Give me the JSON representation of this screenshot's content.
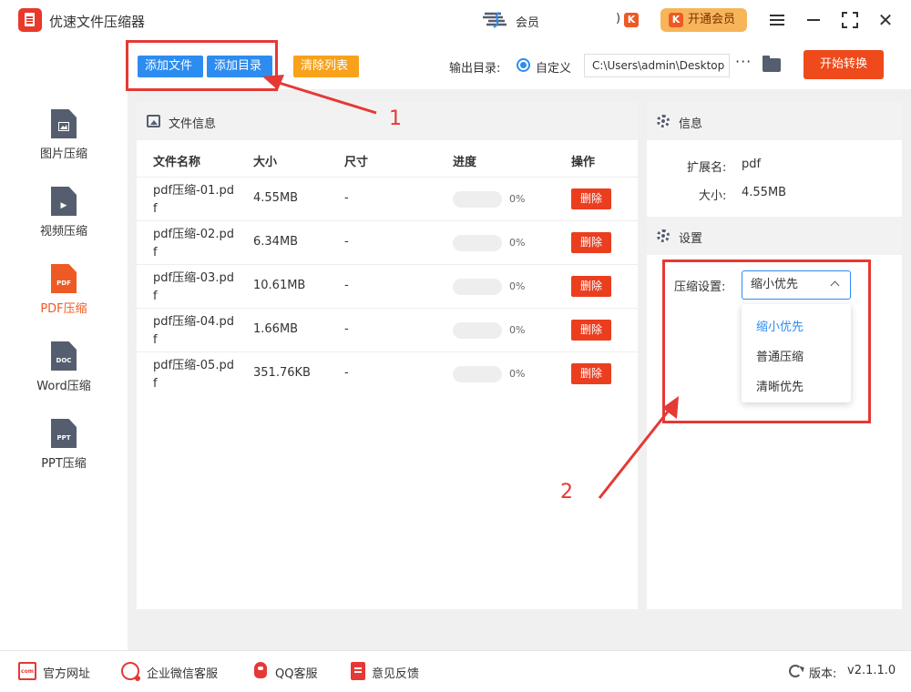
{
  "app": {
    "title": "优速文件压缩器"
  },
  "titlebar": {
    "member_text": "会员",
    "vip_button": "开通会员",
    "vip_badge": "K"
  },
  "toolbar": {
    "add_file": "添加文件",
    "add_dir": "添加目录",
    "clear_list": "清除列表",
    "output_label": "输出目录:",
    "radio_label": "自定义",
    "output_path": "C:\\Users\\admin\\Desktop",
    "more": "···",
    "start": "开始转换"
  },
  "sidebar": {
    "items": [
      {
        "label": "图片压缩",
        "icon": "image-file-icon",
        "tag": ""
      },
      {
        "label": "视频压缩",
        "icon": "video-file-icon",
        "tag": "▶"
      },
      {
        "label": "PDF压缩",
        "icon": "pdf-file-icon",
        "tag": "PDF"
      },
      {
        "label": "Word压缩",
        "icon": "doc-file-icon",
        "tag": "DOC"
      },
      {
        "label": "PPT压缩",
        "icon": "ppt-file-icon",
        "tag": "PPT"
      }
    ]
  },
  "file_panel": {
    "title": "文件信息",
    "columns": [
      "文件名称",
      "大小",
      "尺寸",
      "进度",
      "操作"
    ],
    "rows": [
      {
        "name": "pdf压缩-01.pdf",
        "size": "4.55MB",
        "dim": "-",
        "progress": 0,
        "progress_text": "0%",
        "action": "删除"
      },
      {
        "name": "pdf压缩-02.pdf",
        "size": "6.34MB",
        "dim": "-",
        "progress": 0,
        "progress_text": "0%",
        "action": "删除"
      },
      {
        "name": "pdf压缩-03.pdf",
        "size": "10.61MB",
        "dim": "-",
        "progress": 0,
        "progress_text": "0%",
        "action": "删除"
      },
      {
        "name": "pdf压缩-04.pdf",
        "size": "1.66MB",
        "dim": "-",
        "progress": 0,
        "progress_text": "0%",
        "action": "删除"
      },
      {
        "name": "pdf压缩-05.pdf",
        "size": "351.76KB",
        "dim": "-",
        "progress": 0,
        "progress_text": "0%",
        "action": "删除"
      }
    ]
  },
  "info_panel": {
    "title": "信息",
    "ext_label": "扩展名:",
    "ext_value": "pdf",
    "size_label": "大小:",
    "size_value": "4.55MB",
    "settings_title": "设置",
    "compress_label": "压缩设置:",
    "selected": "缩小优先",
    "options": [
      "缩小优先",
      "普通压缩",
      "清晰优先"
    ]
  },
  "annotations": {
    "label_1": "1",
    "label_2": "2"
  },
  "footer": {
    "website": "官方网址",
    "wechat": "企业微信客服",
    "qq": "QQ客服",
    "feedback": "意见反馈",
    "version_label": "版本:",
    "version": "v2.1.1.0"
  },
  "colors": {
    "accent": "#2d8cf0",
    "danger": "#ea3e1f",
    "warning": "#f8a21b",
    "annotation": "#e53935",
    "active_nav": "#ee5a24"
  }
}
